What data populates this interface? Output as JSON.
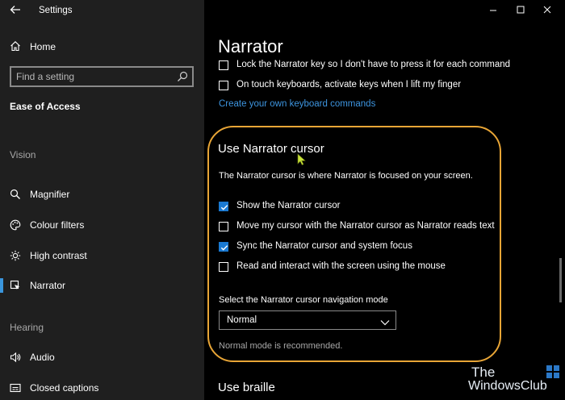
{
  "window": {
    "title": "Settings"
  },
  "sidebar": {
    "home_label": "Home",
    "search_placeholder": "Find a setting",
    "category": "Ease of Access",
    "groups": {
      "vision": "Vision",
      "hearing": "Hearing"
    },
    "items": [
      {
        "label": "Magnifier",
        "icon": "magnifier-icon"
      },
      {
        "label": "Colour filters",
        "icon": "colour-filters-icon"
      },
      {
        "label": "High contrast",
        "icon": "high-contrast-icon"
      },
      {
        "label": "Narrator",
        "icon": "narrator-icon",
        "active": true
      },
      {
        "label": "Audio",
        "icon": "audio-icon"
      },
      {
        "label": "Closed captions",
        "icon": "closed-captions-icon"
      }
    ]
  },
  "main": {
    "page_title": "Narrator",
    "keyboard_options": [
      {
        "label": "Lock the Narrator key so I don't have to press it for each command",
        "checked": false
      },
      {
        "label": "On touch keyboards, activate keys when I lift my finger",
        "checked": false
      }
    ],
    "link_label": "Create your own keyboard commands",
    "cursor_section": {
      "heading": "Use Narrator cursor",
      "description": "The Narrator cursor is where Narrator is focused on your screen.",
      "options": [
        {
          "label": "Show the Narrator cursor",
          "checked": true
        },
        {
          "label": "Move my cursor with the Narrator cursor as Narrator reads text",
          "checked": false
        },
        {
          "label": "Sync the Narrator cursor and system focus",
          "checked": true
        },
        {
          "label": "Read and interact with the screen using the mouse",
          "checked": false
        }
      ],
      "dropdown_label": "Select the Narrator cursor navigation mode",
      "dropdown_value": "Normal",
      "hint": "Normal mode is recommended."
    },
    "next_heading": "Use braille"
  },
  "watermark": {
    "line1": "The",
    "line2": "WindowsClub"
  },
  "colors": {
    "accent": "#1a79d1",
    "link": "#3d95e0",
    "highlight": "#e8a536",
    "sidebar_bg": "#1f1f1f"
  }
}
